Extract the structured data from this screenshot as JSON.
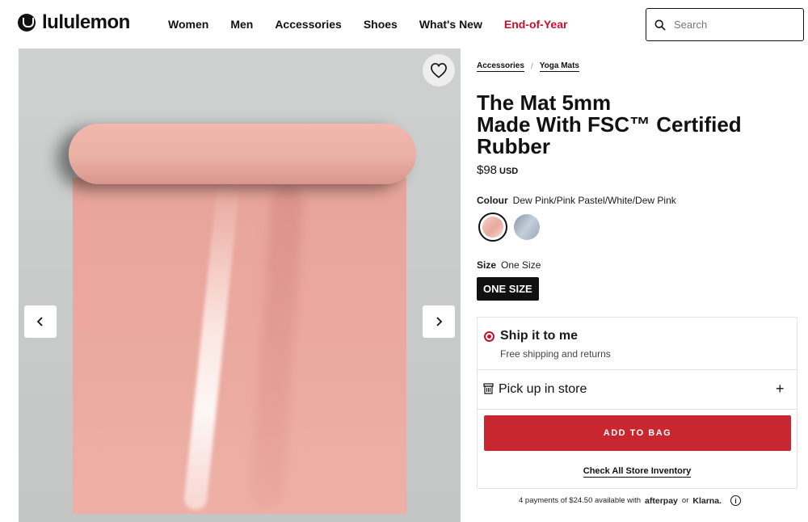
{
  "brand": {
    "name": "lululemon"
  },
  "nav": {
    "items": [
      "Women",
      "Men",
      "Accessories",
      "Shoes",
      "What's New",
      "End-of-Year"
    ]
  },
  "search": {
    "placeholder": "Search"
  },
  "gallery": {
    "wishlist_icon": "heart-outline-icon",
    "prev_icon": "chevron-left-icon",
    "next_icon": "chevron-right-icon"
  },
  "breadcrumb": {
    "items": [
      "Accessories",
      "Yoga Mats"
    ],
    "separator": "/"
  },
  "product": {
    "title_lines": [
      "The Mat 5mm",
      "Made With FSC™ Certified",
      "Rubber"
    ],
    "price": "$98",
    "currency": "USD"
  },
  "colour": {
    "label": "Colour",
    "selected": "Dew Pink/Pink Pastel/White/Dew Pink"
  },
  "size": {
    "label": "Size",
    "selected": "One Size",
    "button": "ONE SIZE"
  },
  "delivery": {
    "ship_title": "Ship it to me",
    "ship_sub": "Free shipping and returns",
    "pickup_title": "Pick up in store",
    "expand_icon": "plus-icon",
    "add_to_bag": "ADD TO BAG",
    "inventory_link": "Check All Store Inventory"
  },
  "payments": {
    "text": "4 payments of $24.50 available with",
    "afterpay": "afterpay",
    "or": "or",
    "klarna": "Klarna.",
    "info": "i"
  },
  "colors": {
    "accent": "#c8272f",
    "promo": "#c8102e",
    "text": "#111111"
  }
}
